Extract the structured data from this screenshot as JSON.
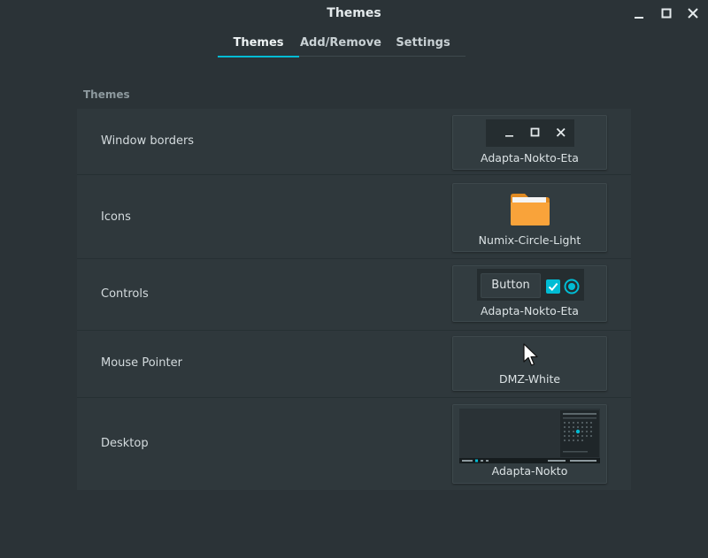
{
  "window": {
    "title": "Themes"
  },
  "tabs": [
    {
      "label": "Themes",
      "active": true
    },
    {
      "label": "Add/Remove",
      "active": false
    },
    {
      "label": "Settings",
      "active": false
    }
  ],
  "section_title": "Themes",
  "rows": [
    {
      "label": "Window borders",
      "theme": "Adapta-Nokto-Eta"
    },
    {
      "label": "Icons",
      "theme": "Numix-Circle-Light"
    },
    {
      "label": "Controls",
      "theme": "Adapta-Nokto-Eta",
      "preview_button_label": "Button"
    },
    {
      "label": "Mouse Pointer",
      "theme": "DMZ-White"
    },
    {
      "label": "Desktop",
      "theme": "Adapta-Nokto"
    }
  ],
  "colors": {
    "accent": "#00bcd4",
    "folder": "#f9a33a",
    "background": "#2b3337"
  }
}
